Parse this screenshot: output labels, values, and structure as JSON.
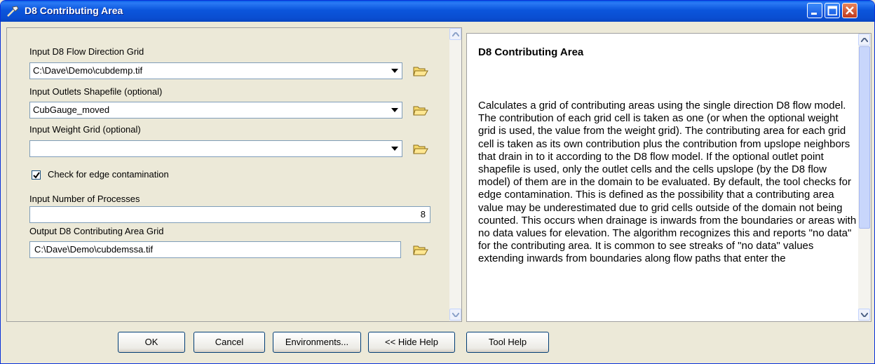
{
  "window": {
    "title": "D8 Contributing Area"
  },
  "form": {
    "flow_dir": {
      "label": "Input D8 Flow Direction Grid",
      "value": "C:\\Dave\\Demo\\cubdemp.tif"
    },
    "outlets": {
      "label": "Input Outlets Shapefile (optional)",
      "value": "CubGauge_moved"
    },
    "weight": {
      "label": "Input Weight Grid (optional)",
      "value": ""
    },
    "edge_check": {
      "label": "Check for edge contamination",
      "checked": true
    },
    "processes": {
      "label": "Input Number of Processes",
      "value": "8"
    },
    "output": {
      "label": "Output D8 Contributing Area Grid",
      "value": "C:\\Dave\\Demo\\cubdemssa.tif"
    }
  },
  "help": {
    "title": "D8 Contributing Area",
    "body": "Calculates a grid of contributing areas using the single direction D8 flow model. The contribution of each grid cell is taken as one (or when the optional weight grid is used, the value from the weight grid). The contributing area for each grid cell is taken as its own contribution plus the contribution from upslope neighbors that drain in to it according to the D8 flow model. If the optional outlet point shapefile is used, only the outlet cells and the cells upslope (by the D8 flow model) of them are in the domain to be evaluated. By default, the tool checks for edge contamination. This is defined as the possibility that a contributing area value may be underestimated due to grid cells outside of the domain not being counted. This occurs when drainage is inwards from the boundaries or areas with no data values for elevation. The algorithm recognizes this and reports \"no data\" for the contributing area. It is common to see streaks of \"no data\" values extending inwards from boundaries along flow paths that enter the"
  },
  "buttons": {
    "ok": "OK",
    "cancel": "Cancel",
    "environments": "Environments...",
    "hide_help": "<< Hide Help",
    "tool_help": "Tool Help"
  },
  "icons": [
    "hammer-icon",
    "minimize-icon",
    "maximize-icon",
    "close-icon",
    "folder-open-icon",
    "dropdown-arrow-icon",
    "scroll-up-icon",
    "scroll-down-icon"
  ]
}
